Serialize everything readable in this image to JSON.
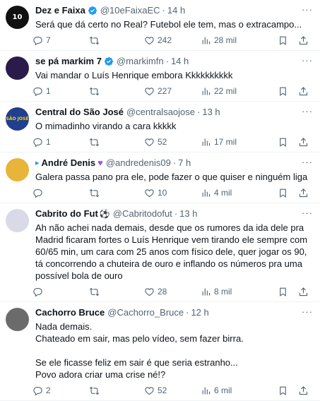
{
  "tweets": [
    {
      "name": "Dez e Faixa",
      "handle": "@10eFaixaEC",
      "time": "14 h",
      "text": "Será que dá certo no Real? Futebol ele tem, mas o extracampo...",
      "replies": "7",
      "retweets": "",
      "likes": "242",
      "views": "28 mil",
      "verified": true,
      "avatar_text": "10",
      "avatar_bg": "#111111",
      "avatar_fg": "#ffffff"
    },
    {
      "name": "se pá markim 7",
      "handle": "@markimfn",
      "time": "14 h",
      "text": "Vai mandar o Luís Henrique embora Kkkkkkkkkk",
      "replies": "1",
      "retweets": "",
      "likes": "227",
      "views": "22 mil",
      "verified": true,
      "avatar_text": "",
      "avatar_bg": "#2b1b4a",
      "avatar_fg": "#ffffff"
    },
    {
      "name": "Central do São José",
      "handle": "@centralsaojose",
      "time": "13 h",
      "text": "O mimadinho virando a cara kkkkk",
      "replies": "1",
      "retweets": "",
      "likes": "52",
      "views": "17 mil",
      "verified": false,
      "avatar_text": "SÃO JOSÉ",
      "avatar_bg": "#1f3f8f",
      "avatar_fg": "#ffd200"
    },
    {
      "name": "André Denis",
      "handle": "@andredenis09",
      "time": "7 h",
      "text": "Galera passa pano pra ele, pode fazer o que quiser e ninguém liga",
      "replies": "",
      "retweets": "",
      "likes": "10",
      "views": "4 mil",
      "verified": false,
      "avatar_text": "",
      "avatar_bg": "#e8b53a",
      "avatar_fg": "#1d3f7a"
    },
    {
      "name": "Cabrito do Fut",
      "handle": "@Cabritodofut",
      "time": "13 h",
      "text": "Ah não achei nada demais, desde que os rumores da ida dele pra Madrid ficaram fortes o Luís Henrique vem tirando ele sempre com 60/65 min, um cara com 25 anos com físico dele, quer jogar os 90, tá concorrendo a chuteira de ouro e inflando os números pra uma possível bola de ouro",
      "replies": "",
      "retweets": "",
      "likes": "28",
      "views": "8 mil",
      "verified": false,
      "avatar_text": "",
      "avatar_bg": "#d9d9e8",
      "avatar_fg": "#222222"
    },
    {
      "name": "Cachorro Bruce",
      "handle": "@Cachorro_Bruce",
      "time": "12 h",
      "text": "Nada demais.\nChateado em sair, mas pelo vídeo, sem fazer birra.\n\nSe ele ficasse feliz em sair é que seria estranho...\nPovo adora criar uma crise né!?",
      "replies": "2",
      "retweets": "",
      "likes": "52",
      "views": "6 mil",
      "verified": false,
      "avatar_text": "",
      "avatar_bg": "#6b6b6b",
      "avatar_fg": "#ffffff"
    }
  ],
  "colors": {
    "verified": "#1d9bf0",
    "secondary": "#536471",
    "divider": "#eff3f4"
  },
  "icons": {
    "reply": "reply-icon",
    "retweet": "retweet-icon",
    "like": "heart-icon",
    "views": "views-icon",
    "bookmark": "bookmark-icon",
    "share": "share-icon",
    "more": "more-icon"
  }
}
